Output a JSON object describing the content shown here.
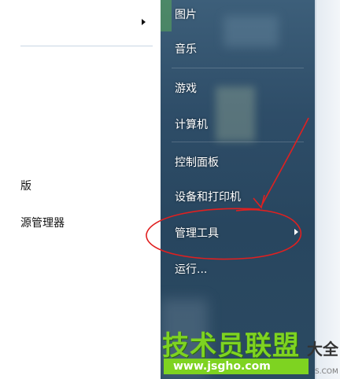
{
  "left_pane": {
    "items": [
      {
        "label": "版"
      },
      {
        "label": "源管理器"
      }
    ]
  },
  "start_menu": {
    "items": [
      {
        "label": "图片"
      },
      {
        "label": "音乐"
      },
      {
        "label": "游戏"
      },
      {
        "label": "计算机"
      },
      {
        "label": "控制面板"
      },
      {
        "label": "设备和打印机"
      },
      {
        "label": "管理工具"
      },
      {
        "label": "运行..."
      }
    ]
  },
  "watermark": {
    "title": "技术员联盟",
    "suffix": "大全",
    "url": "www.jsgho.com",
    "small": "S.COM"
  },
  "annotation_color": "#e02020"
}
